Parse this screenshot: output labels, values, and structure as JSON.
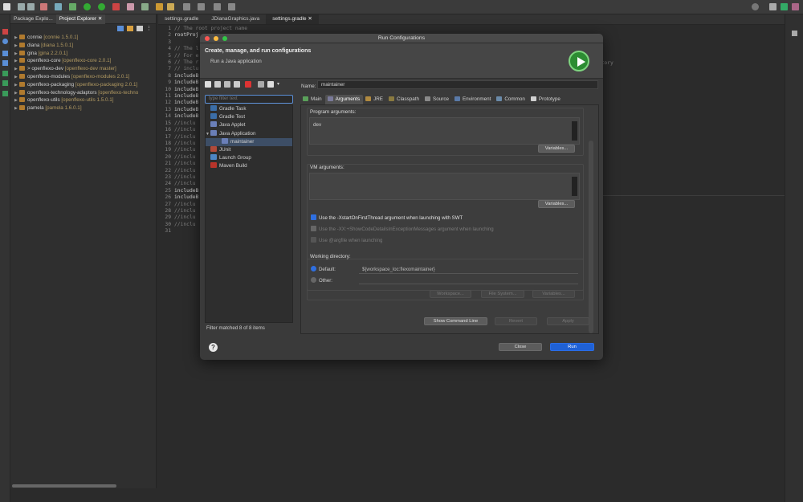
{
  "editor_tabs": [
    "settings.gradle",
    "JDianaGraphics.java",
    "settings.gradle"
  ],
  "explorer": {
    "tabs": [
      "Package Explo...",
      "Project Explorer"
    ],
    "projects": [
      {
        "name": "connie",
        "deco": "[connie 1.5.0.1]"
      },
      {
        "name": "diana",
        "deco": "[diana 1.5.0.1]"
      },
      {
        "name": "gina",
        "deco": "[gina 2.2.0.1]"
      },
      {
        "name": "openflexo-core",
        "deco": "[openflexo-core 2.0.1]"
      },
      {
        "name": "> openflexo-dev",
        "deco": "[openflexo-dev master]"
      },
      {
        "name": "openflexo-modules",
        "deco": "[openflexo-modules 2.0.1]"
      },
      {
        "name": "openflexo-packaging",
        "deco": "[openflexo-packaging 2.0.1]"
      },
      {
        "name": "openflexo-technology-adaptors",
        "deco": "[openflexo-techno"
      },
      {
        "name": "openflexo-utils",
        "deco": "[openflexo-utils 1.5.0.1]"
      },
      {
        "name": "pamela",
        "deco": "[pamela 1.6.0.1]"
      }
    ]
  },
  "code_lines": [
    {
      "n": "1",
      "t": "// The root project name",
      "c": true
    },
    {
      "n": "2",
      "t": "rootProj",
      "c": false
    },
    {
      "n": "3",
      "t": "",
      "c": false
    },
    {
      "n": "4",
      "t": "// The l",
      "c": true
    },
    {
      "n": "5",
      "t": "// For e",
      "c": true
    },
    {
      "n": "6",
      "t": "// The r",
      "c": true
    },
    {
      "n": "7",
      "t": "// inclu",
      "c": true
    },
    {
      "n": "8",
      "t": "includeB",
      "c": false
    },
    {
      "n": "9",
      "t": "includeB",
      "c": false
    },
    {
      "n": "10",
      "t": "includeB",
      "c": false
    },
    {
      "n": "11",
      "t": "includeB",
      "c": false
    },
    {
      "n": "12",
      "t": "includeB",
      "c": false
    },
    {
      "n": "13",
      "t": "includeB",
      "c": false
    },
    {
      "n": "14",
      "t": "includeB",
      "c": false
    },
    {
      "n": "15",
      "t": "//inclu",
      "c": true
    },
    {
      "n": "16",
      "t": "//inclu",
      "c": true
    },
    {
      "n": "17",
      "t": "//inclu",
      "c": true
    },
    {
      "n": "18",
      "t": "//inclu",
      "c": true
    },
    {
      "n": "19",
      "t": "//inclu",
      "c": true
    },
    {
      "n": "20",
      "t": "//inclu",
      "c": true
    },
    {
      "n": "21",
      "t": "//inclu",
      "c": true
    },
    {
      "n": "22",
      "t": "//inclu",
      "c": true
    },
    {
      "n": "23",
      "t": "//inclu",
      "c": true
    },
    {
      "n": "24",
      "t": "//inclu",
      "c": true
    },
    {
      "n": "25",
      "t": "includeB",
      "c": false
    },
    {
      "n": "26",
      "t": "includeB",
      "c": false
    },
    {
      "n": "27",
      "t": "//inclu",
      "c": true
    },
    {
      "n": "28",
      "t": "//inclu",
      "c": true
    },
    {
      "n": "29",
      "t": "//inclu",
      "c": true
    },
    {
      "n": "30",
      "t": "//inclu",
      "c": true
    },
    {
      "n": "31",
      "t": "",
      "c": false
    }
  ],
  "editor_bg_text": "ectory",
  "dialog": {
    "title": "Run Configurations",
    "header_title": "Create, manage, and run configurations",
    "header_subtitle": "Run a Java application",
    "filter_placeholder": "type filter text",
    "tree": [
      {
        "label": "Gradle Task",
        "indent": 1,
        "color": "#3b6ea8",
        "arrow": ""
      },
      {
        "label": "Gradle Test",
        "indent": 1,
        "color": "#3b6ea8",
        "arrow": ""
      },
      {
        "label": "Java Applet",
        "indent": 1,
        "color": "#6a7fb8",
        "arrow": ""
      },
      {
        "label": "Java Application",
        "indent": 1,
        "color": "#6a7fb8",
        "arrow": "▼"
      },
      {
        "label": "maintainer",
        "indent": 2,
        "color": "#6a7fb8",
        "arrow": "",
        "selected": true
      },
      {
        "label": "JUnit",
        "indent": 1,
        "color": "#b04a3a",
        "arrow": ""
      },
      {
        "label": "Launch Group",
        "indent": 1,
        "color": "#4d86c4",
        "arrow": ""
      },
      {
        "label": "Maven Build",
        "indent": 1,
        "color": "#b8342a",
        "arrow": ""
      }
    ],
    "filter_matched": "Filter matched 8 of 8 items",
    "name_label": "Name:",
    "name_value": "maintainer",
    "tabs": [
      {
        "label": "Main",
        "color": "#5aa05a"
      },
      {
        "label": "Arguments",
        "color": "#7a7a9a",
        "active": true
      },
      {
        "label": "JRE",
        "color": "#b08a40"
      },
      {
        "label": "Classpath",
        "color": "#8a7a40"
      },
      {
        "label": "Source",
        "color": "#8a8a8a"
      },
      {
        "label": "Environment",
        "color": "#5a7aa8"
      },
      {
        "label": "Common",
        "color": "#6a8aa8"
      },
      {
        "label": "Prototype",
        "color": "#d0d0d0"
      }
    ],
    "program_args_label": "Program arguments:",
    "program_args_value": "dev",
    "variables_label": "Variables...",
    "vm_args_label": "VM arguments:",
    "check_xstart": "Use the -XstartOnFirstThread argument when launching with SWT",
    "check_xx": "Use the -XX:+ShowCodeDetailsInExceptionMessages argument when launching",
    "check_argfile": "Use @argfile when launching",
    "working_dir_label": "Working directory:",
    "default_label": "Default:",
    "default_value": "${workspace_loc:flexomaintainer}",
    "other_label": "Other:",
    "workspace_btn": "Workspace...",
    "filesystem_btn": "File System...",
    "show_cmd_btn": "Show Command Line",
    "revert_btn": "Revert",
    "apply_btn": "Apply",
    "close_btn": "Close",
    "run_btn": "Run",
    "help_glyph": "?"
  },
  "colors": {
    "accent": "#1f61d6",
    "run_green": "#2c8c32"
  }
}
